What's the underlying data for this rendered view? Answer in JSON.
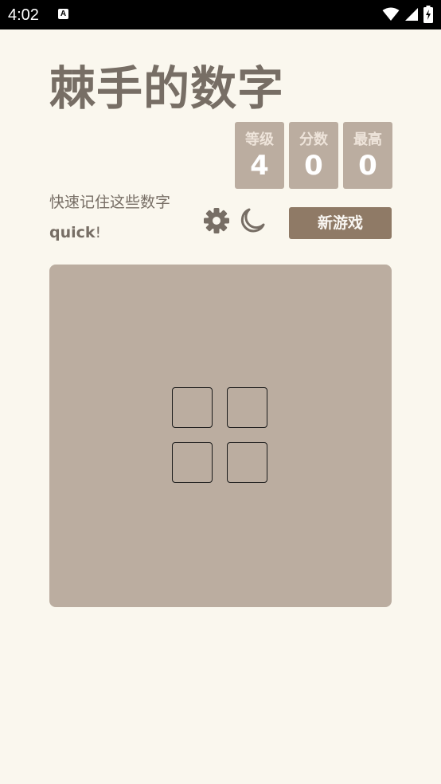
{
  "status_bar": {
    "time": "4:02",
    "notification_icon": "A"
  },
  "header": {
    "title": "棘手的数字"
  },
  "scores": [
    {
      "label": "等级",
      "value": "4"
    },
    {
      "label": "分数",
      "value": "0"
    },
    {
      "label": "最高",
      "value": "0"
    }
  ],
  "intro": {
    "tagline": "快速记住这些数字",
    "sub_bold": "quick",
    "sub_rest": "!"
  },
  "controls": {
    "settings_icon": "gear-icon",
    "theme_icon": "moon-icon",
    "new_game_label": "新游戏"
  },
  "board": {
    "rows": 2,
    "cols": 2,
    "cells": [
      "",
      "",
      "",
      ""
    ]
  },
  "colors": {
    "background": "#faf7ee",
    "board": "#bbada0",
    "text": "#776e65",
    "button": "#8f7a66"
  }
}
